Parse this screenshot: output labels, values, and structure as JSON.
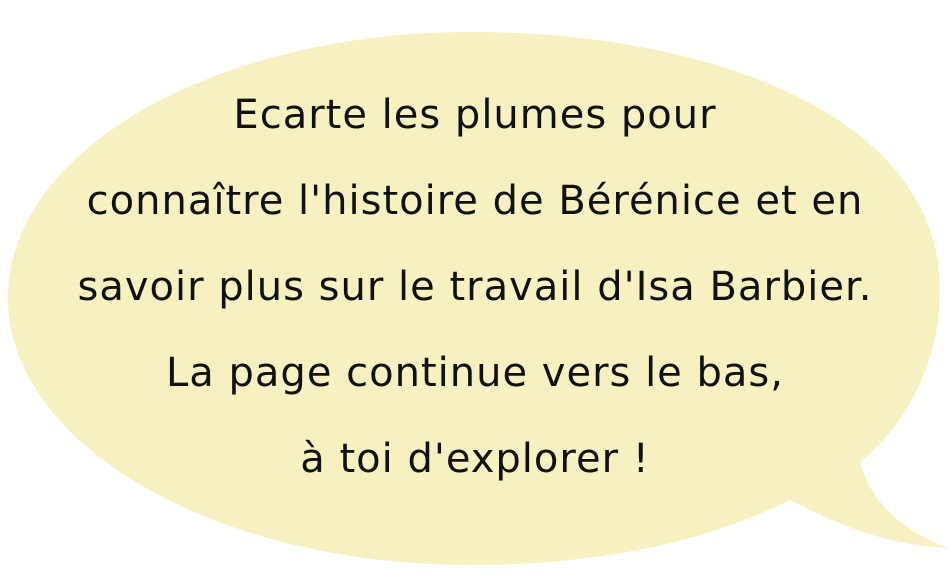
{
  "speech_bubble": {
    "fill_color": "#f7f1c1",
    "text_color": "#111111",
    "lines": [
      "Ecarte les plumes pour",
      "connaître l'histoire de Bérénice et en",
      "savoir plus sur le travail d'Isa Barbier.",
      "La page continue vers le bas,",
      "à toi d'explorer !"
    ]
  }
}
